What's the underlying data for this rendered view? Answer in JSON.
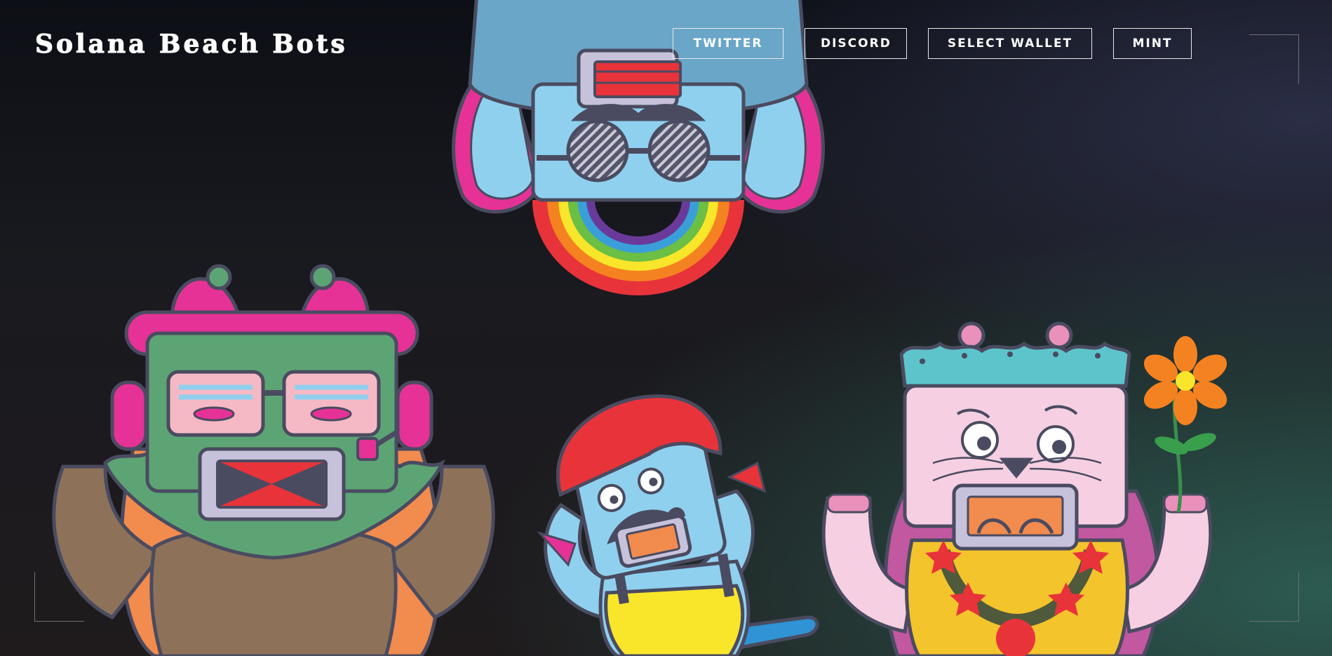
{
  "header": {
    "brand": "Solana Beach Bots"
  },
  "nav": {
    "twitter": "Twitter",
    "discord": "Discord",
    "wallet": "Select Wallet",
    "mint": "Mint"
  },
  "colors": {
    "accent_pink": "#e63296",
    "green_bot": "#5da475",
    "blue_bot": "#8fd0ef",
    "pink_bot": "#f6cfe3",
    "yellow": "#f9e52a",
    "red": "#e8333a",
    "outline": "#4a4b60"
  }
}
